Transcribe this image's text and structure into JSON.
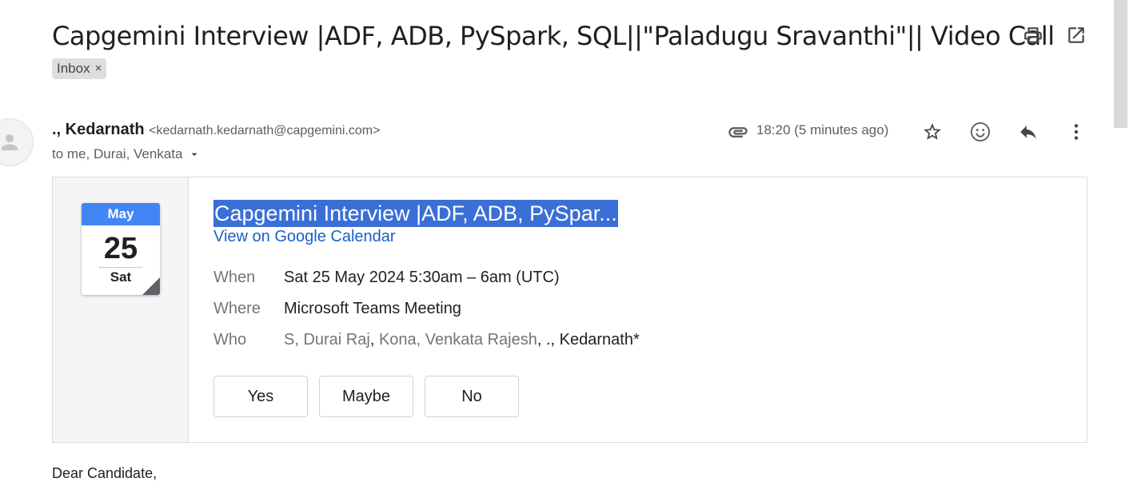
{
  "email": {
    "subject": "Capgemini Interview |ADF, ADB, PySpark, SQL||\"Paladugu Sravanthi\"|| Video Call",
    "label_chip": "Inbox",
    "label_chip_close": "×",
    "sender_name": "., Kedarnath",
    "sender_email": "<kedarnath.kedarnath@capgemini.com>",
    "recipients": "to me, Durai, Venkata",
    "time": "18:20 (5 minutes ago)",
    "body_greeting": "Dear Candidate,"
  },
  "invite": {
    "calendar_month": "May",
    "calendar_day": "25",
    "calendar_weekday": "Sat",
    "title": "Capgemini Interview |ADF, ADB, PySpar...",
    "view_link": "View on Google Calendar",
    "when_label": "When",
    "when_value": "Sat 25 May 2024 5:30am – 6am (UTC)",
    "where_label": "Where",
    "where_value": "Microsoft Teams Meeting",
    "who_label": "Who",
    "who_part1": "S, Durai Raj",
    "who_sep1": ", ",
    "who_part2": "Kona, Venkata Rajesh",
    "who_sep2": ", ",
    "who_part3": "., Kedarnath*",
    "rsvp_yes": "Yes",
    "rsvp_maybe": "Maybe",
    "rsvp_no": "No"
  },
  "icons": {
    "print": "print-icon",
    "open_new_window": "open-in-new-window-icon",
    "attachment": "paperclip-icon",
    "star": "star-icon",
    "emoji": "emoji-reaction-icon",
    "reply": "reply-icon",
    "more": "more-vert-icon",
    "expand_recipients": "chevron-down-icon",
    "avatar": "person-icon"
  },
  "colors": {
    "calendar_month_bg": "#4285f4",
    "title_highlight": "#3a6fd6",
    "link": "#1a5fc8"
  }
}
